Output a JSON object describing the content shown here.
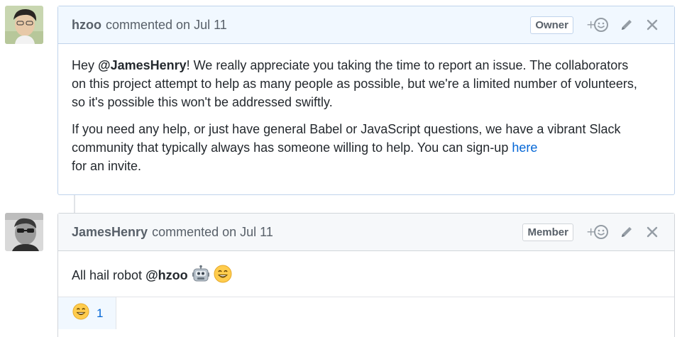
{
  "comments": [
    {
      "author": "hzoo",
      "meta": "commented on Jul 11",
      "role": "Owner",
      "body": {
        "p1_pre": "Hey ",
        "p1_mention": "@JamesHenry",
        "p1_line1": "! We really appreciate you taking the time to report an issue. The collaborators",
        "p1_line2": "on this project attempt to help as many people as possible, but we're a limited number of volunteers,",
        "p1_line3": "so it's possible this won't be addressed swiftly.",
        "p2_line1": "If you need any help, or just have general Babel or JavaScript questions, we have a vibrant Slack",
        "p2_line2": "community that typically always has someone willing to help. You can sign-up ",
        "p2_link": "here",
        "p2_line3": "for an invite."
      }
    },
    {
      "author": "JamesHenry",
      "meta": "commented on Jul 11",
      "role": "Member",
      "body": {
        "text": "All hail robot ",
        "mention": "@hzoo"
      },
      "reactions": [
        {
          "emoji": "smile",
          "count": "1"
        }
      ]
    }
  ],
  "icons": {
    "add_reaction": "smiley-plus-icon",
    "edit": "pencil-icon",
    "delete": "close-icon"
  },
  "colors": {
    "link": "#0366d6",
    "owner_header_bg": "#f1f8ff",
    "owner_border": "#c0d3eb",
    "member_header_bg": "#f6f8fa"
  }
}
